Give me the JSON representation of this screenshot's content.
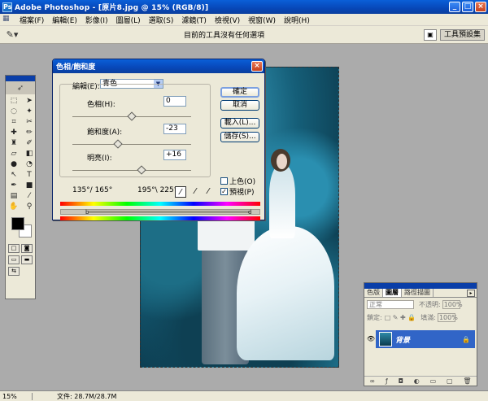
{
  "window": {
    "title": "Adobe Photoshop - [原片8.jpg @ 15% (RGB/8)]",
    "app_icon": "Ps",
    "minimize": "_",
    "maximize": "□",
    "close": "×"
  },
  "menu": [
    "檔案(F)",
    "編輯(E)",
    "影像(I)",
    "圖層(L)",
    "選取(S)",
    "濾鏡(T)",
    "檢視(V)",
    "視窗(W)",
    "說明(H)"
  ],
  "optbar": {
    "message": "目前的工具沒有任何選項",
    "palette_tab": "工具預設集"
  },
  "dialog": {
    "title": "色相/飽和度",
    "edit_label": "編輯(E):",
    "edit_value": "青色",
    "hue_label": "色相(H):",
    "hue_value": "0",
    "saturation_label": "飽和度(A):",
    "saturation_value": "-23",
    "lightness_label": "明亮(I):",
    "lightness_value": "+16",
    "range_left": "135°/ 165°",
    "range_right": "195°\\ 225°",
    "ok": "確定",
    "cancel": "取消",
    "load": "載入(L)...",
    "save": "儲存(S)...",
    "colorize": "上色(O)",
    "preview": "預視(P)",
    "preview_checked": "✓",
    "range_mark_left": "b",
    "range_mark_right": "d",
    "hue_level": 0.5,
    "saturation_level": 0.385,
    "lightness_level": 0.58
  },
  "layers_panel": {
    "tabs": [
      "色版",
      "圖層",
      "路徑描圖"
    ],
    "blend_mode": "正常",
    "opacity_label": "不透明:",
    "opacity_value": "100%",
    "lock_label": "鎖定:",
    "fill_label": "填滿:",
    "fill_value": "100%",
    "layer_name": "背景"
  },
  "status": {
    "zoom": "15%",
    "doc_info": "文件: 28.7M/28.7M"
  }
}
